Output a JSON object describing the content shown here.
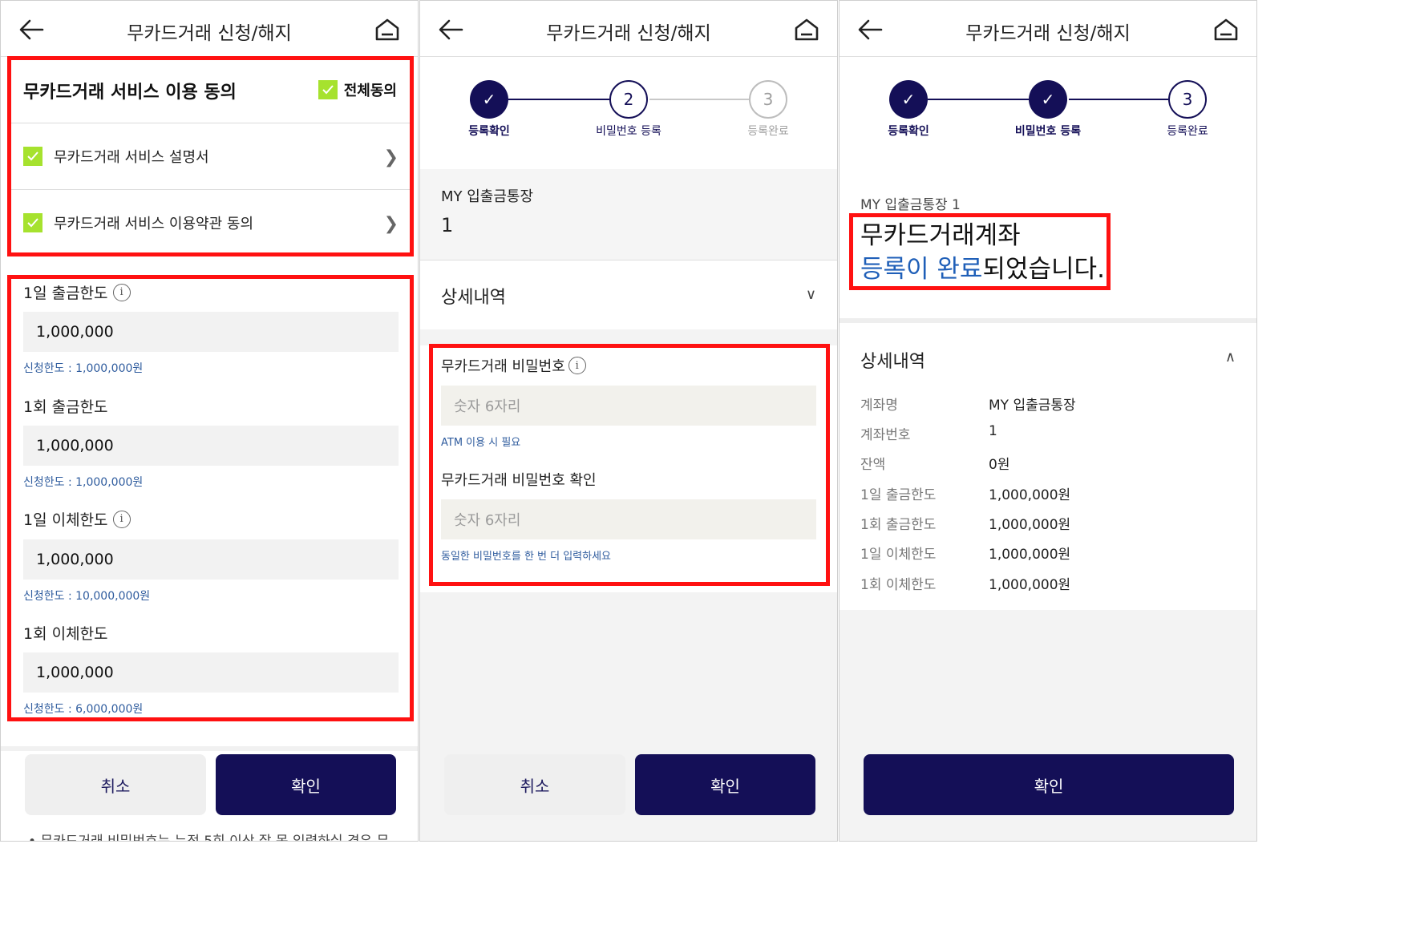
{
  "header": {
    "title": "무카드거래 신청/해지"
  },
  "screen1": {
    "agree_title": "무카드거래 서비스 이용 동의",
    "all_agree": "전체동의",
    "agree_items": [
      "무카드거래 서비스 설명서",
      "무카드거래 서비스 이용약관 동의"
    ],
    "limits": [
      {
        "label": "1일 출금한도",
        "value": "1,000,000",
        "note": "신청한도 : 1,000,000원",
        "info": true
      },
      {
        "label": "1회 출금한도",
        "value": "1,000,000",
        "note": "신청한도 : 1,000,000원",
        "info": false
      },
      {
        "label": "1일 이체한도",
        "value": "1,000,000",
        "note": "신청한도 : 10,000,000원",
        "info": true
      },
      {
        "label": "1회 이체한도",
        "value": "1,000,000",
        "note": "신청한도 : 6,000,000원",
        "info": false
      }
    ],
    "cancel": "취소",
    "confirm": "확인",
    "footnote": "• 무카드거래 비밀번호는 누적 5회 이상 잘 못 입력하실 경우 무"
  },
  "steps": {
    "labels": [
      "등록확인",
      "비밀번호 등록",
      "등록완료"
    ],
    "numbers": [
      "2",
      "3"
    ]
  },
  "screen2": {
    "account_name": "MY 입출금통장",
    "account_number": "1",
    "detail_title": "상세내역",
    "pw_label": "무카드거래 비밀번호",
    "pw_placeholder": "숫자 6자리",
    "pw_note": "ATM 이용 시 필요",
    "pw_confirm_label": "무카드거래 비밀번호 확인",
    "pw_confirm_placeholder": "숫자 6자리",
    "pw_confirm_note": "동일한 비밀번호를 한 번 더 입력하세요",
    "cancel": "취소",
    "confirm": "확인"
  },
  "screen3": {
    "account_line": "MY 입출금통장 1",
    "done_line1": "무카드거래계좌",
    "done_blue": "등록이 완료",
    "done_rest": "되었습니다.",
    "detail_title": "상세내역",
    "details": [
      {
        "k": "계좌명",
        "v": "MY 입출금통장"
      },
      {
        "k": "계좌번호",
        "v": "1"
      },
      {
        "k": "잔액",
        "v": "0원"
      },
      {
        "k": "1일 출금한도",
        "v": "1,000,000원"
      },
      {
        "k": "1회 출금한도",
        "v": "1,000,000원"
      },
      {
        "k": "1일 이체한도",
        "v": "1,000,000원"
      },
      {
        "k": "1회 이체한도",
        "v": "1,000,000원"
      }
    ],
    "confirm": "확인"
  },
  "colors": {
    "navy": "#140f57",
    "highlight_red": "#ff1111",
    "check_green": "#a6e22e",
    "link_blue": "#2f5c9e"
  }
}
